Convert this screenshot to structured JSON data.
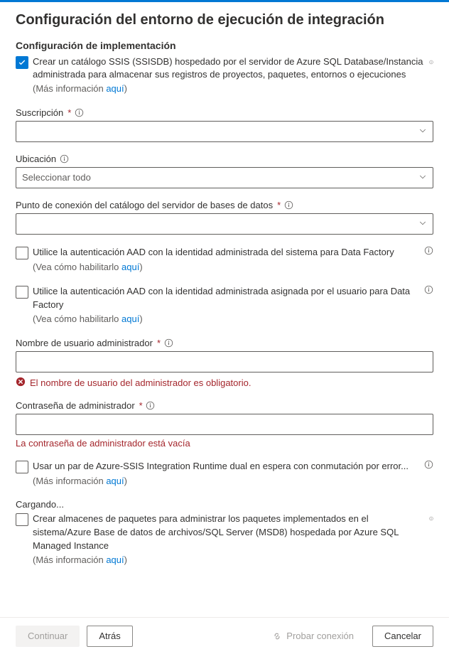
{
  "title": "Configuración del entorno de ejecución de integración",
  "sectionHeader": "Configuración de implementación",
  "ssisdb": {
    "label": "Crear un catálogo SSIS (SSISDB) hospedado por el servidor de Azure SQL Database/Instancia administrada para almacenar sus registros de proyectos, paquetes, entornos o ejecuciones",
    "hintPrefix": "(Más información ",
    "hintLink": "aquí",
    "hintSuffix": ")"
  },
  "subscription": {
    "label": "Suscripción"
  },
  "location": {
    "label": "Ubicación",
    "placeholder": "Seleccionar todo"
  },
  "endpoint": {
    "label": "Punto de conexión del catálogo del servidor de bases de datos"
  },
  "aadSystem": {
    "label": "Utilice la autenticación AAD con la identidad administrada del sistema para Data Factory",
    "hintPrefix": "(Vea cómo habilitarlo ",
    "hintLink": "aquí",
    "hintSuffix": ")"
  },
  "aadUser": {
    "label": "Utilice la autenticación AAD con la identidad administrada asignada por el usuario para Data Factory",
    "hintPrefix": "(Vea cómo habilitarlo ",
    "hintLink": "aquí",
    "hintSuffix": ")"
  },
  "adminUser": {
    "label": "Nombre de usuario administrador",
    "error": "El nombre de usuario del administrador es obligatorio."
  },
  "adminPass": {
    "label": "Contraseña de administrador",
    "error": "La contraseña de administrador está vacía"
  },
  "dualStandby": {
    "label": "Usar un par de Azure-SSIS Integration Runtime dual en espera con conmutación por error...",
    "hintPrefix": "(Más información ",
    "hintLink": "aquí",
    "hintSuffix": ")"
  },
  "loading": "Cargando...",
  "packageStores": {
    "label": "Crear almacenes de paquetes para administrar los paquetes implementados en el sistema/Azure Base de datos de archivos/SQL Server (MSD8) hospedada por Azure SQL Managed Instance",
    "hintPrefix": "(Más información ",
    "hintLink": "aquí",
    "hintSuffix": ")"
  },
  "footer": {
    "continue": "Continuar",
    "back": "Atrás",
    "test": "Probar conexión",
    "cancel": "Cancelar"
  }
}
